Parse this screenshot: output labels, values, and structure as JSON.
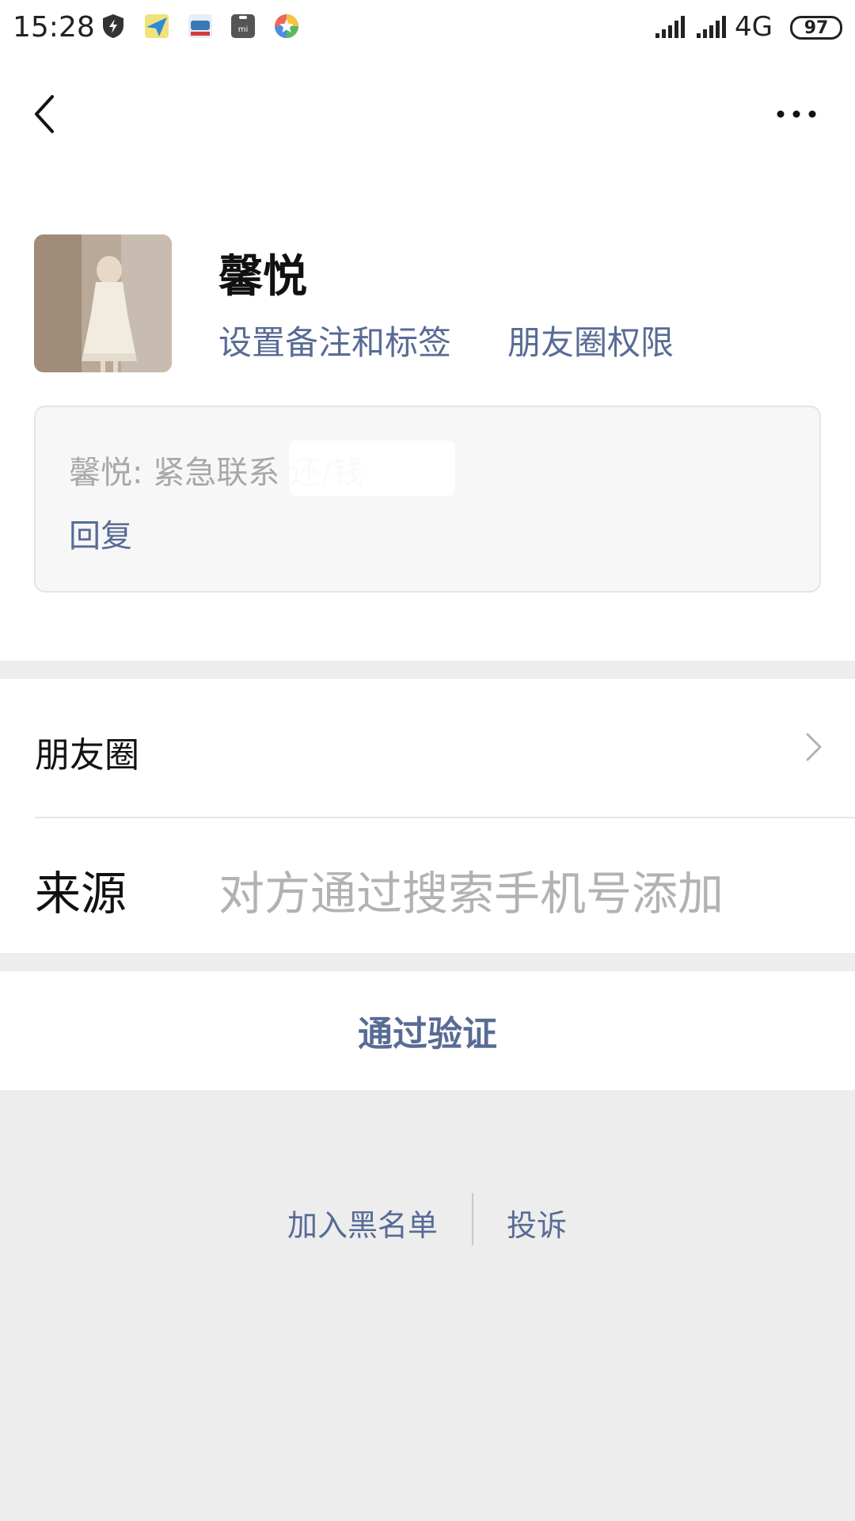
{
  "status_bar": {
    "time": "15:28",
    "network": "4G",
    "battery": "97",
    "icons": [
      "shield-icon",
      "plane-icon",
      "car-icon",
      "mi-icon",
      "star-icon",
      "signal-icon",
      "signal-icon"
    ]
  },
  "nav": {
    "back_icon": "chevron-left-icon",
    "more_icon": "more-icon"
  },
  "profile": {
    "name": "馨悦",
    "remark_link": "设置备注和标签",
    "moments_permission_link": "朋友圈权限"
  },
  "message": {
    "text": "馨悦: 紧急联系         还/钱",
    "reply": "回复"
  },
  "list": {
    "moments_label": "朋友圈",
    "source_label": "来源",
    "source_value": "对方通过搜索手机号添加"
  },
  "actions": {
    "verify": "通过验证",
    "blacklist": "加入黑名单",
    "complain": "投诉"
  },
  "colors": {
    "link": "#576b95",
    "background": "#ededed"
  }
}
